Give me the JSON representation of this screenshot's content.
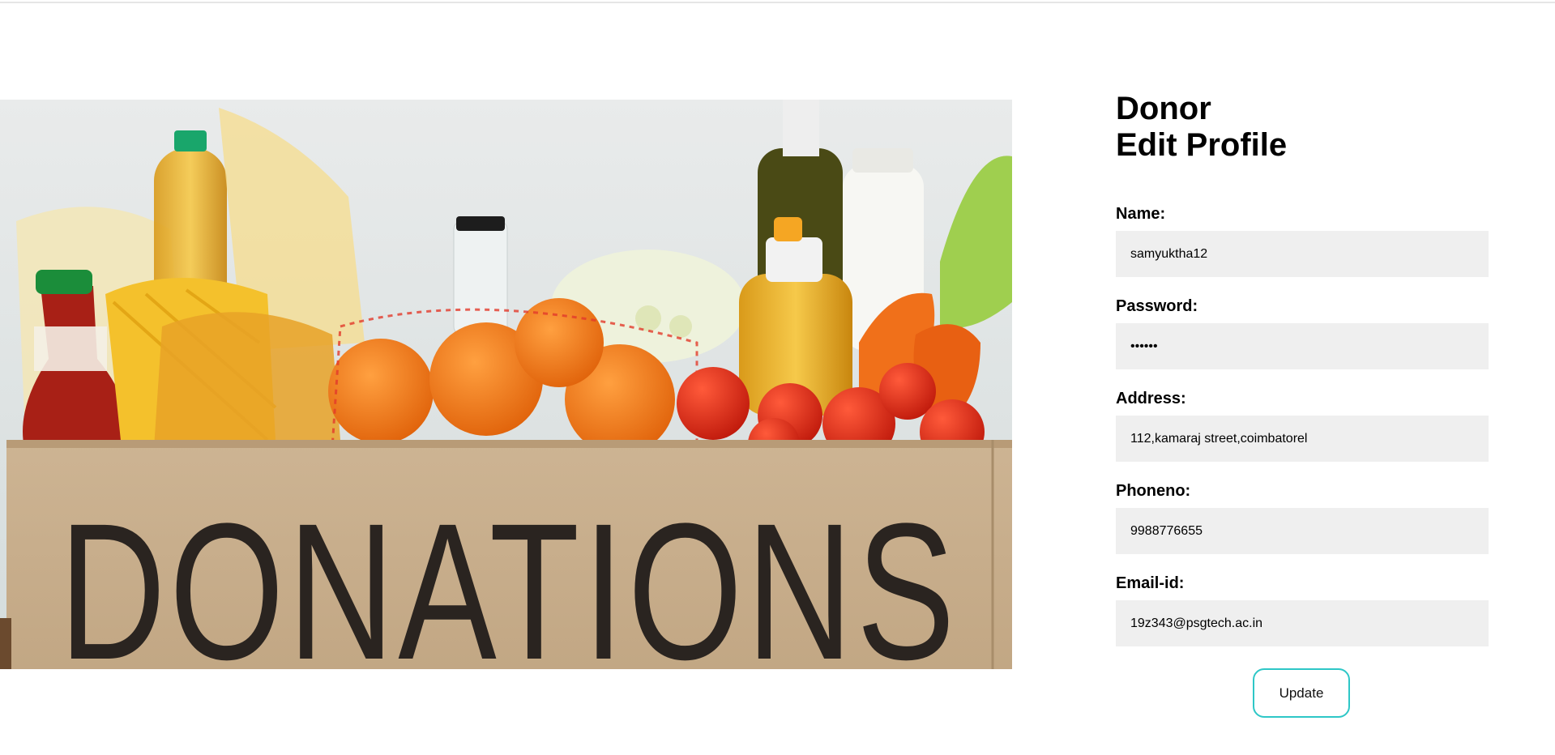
{
  "hero": {
    "box_label": "DONATIONS"
  },
  "form": {
    "title_line1": "Donor",
    "title_line2": "Edit Profile",
    "name": {
      "label": "Name:",
      "value": "samyuktha12"
    },
    "password": {
      "label": "Password:",
      "value": "samyuk"
    },
    "address": {
      "label": "Address:",
      "value": "112,kamaraj street,coimbatorel"
    },
    "phone": {
      "label": "Phoneno:",
      "value": "9988776655"
    },
    "email": {
      "label": "Email-id:",
      "value": "19z343@psgtech.ac.in"
    },
    "update_label": "Update"
  },
  "colors": {
    "button_border": "#2ec7c7",
    "input_background": "#efefef"
  }
}
